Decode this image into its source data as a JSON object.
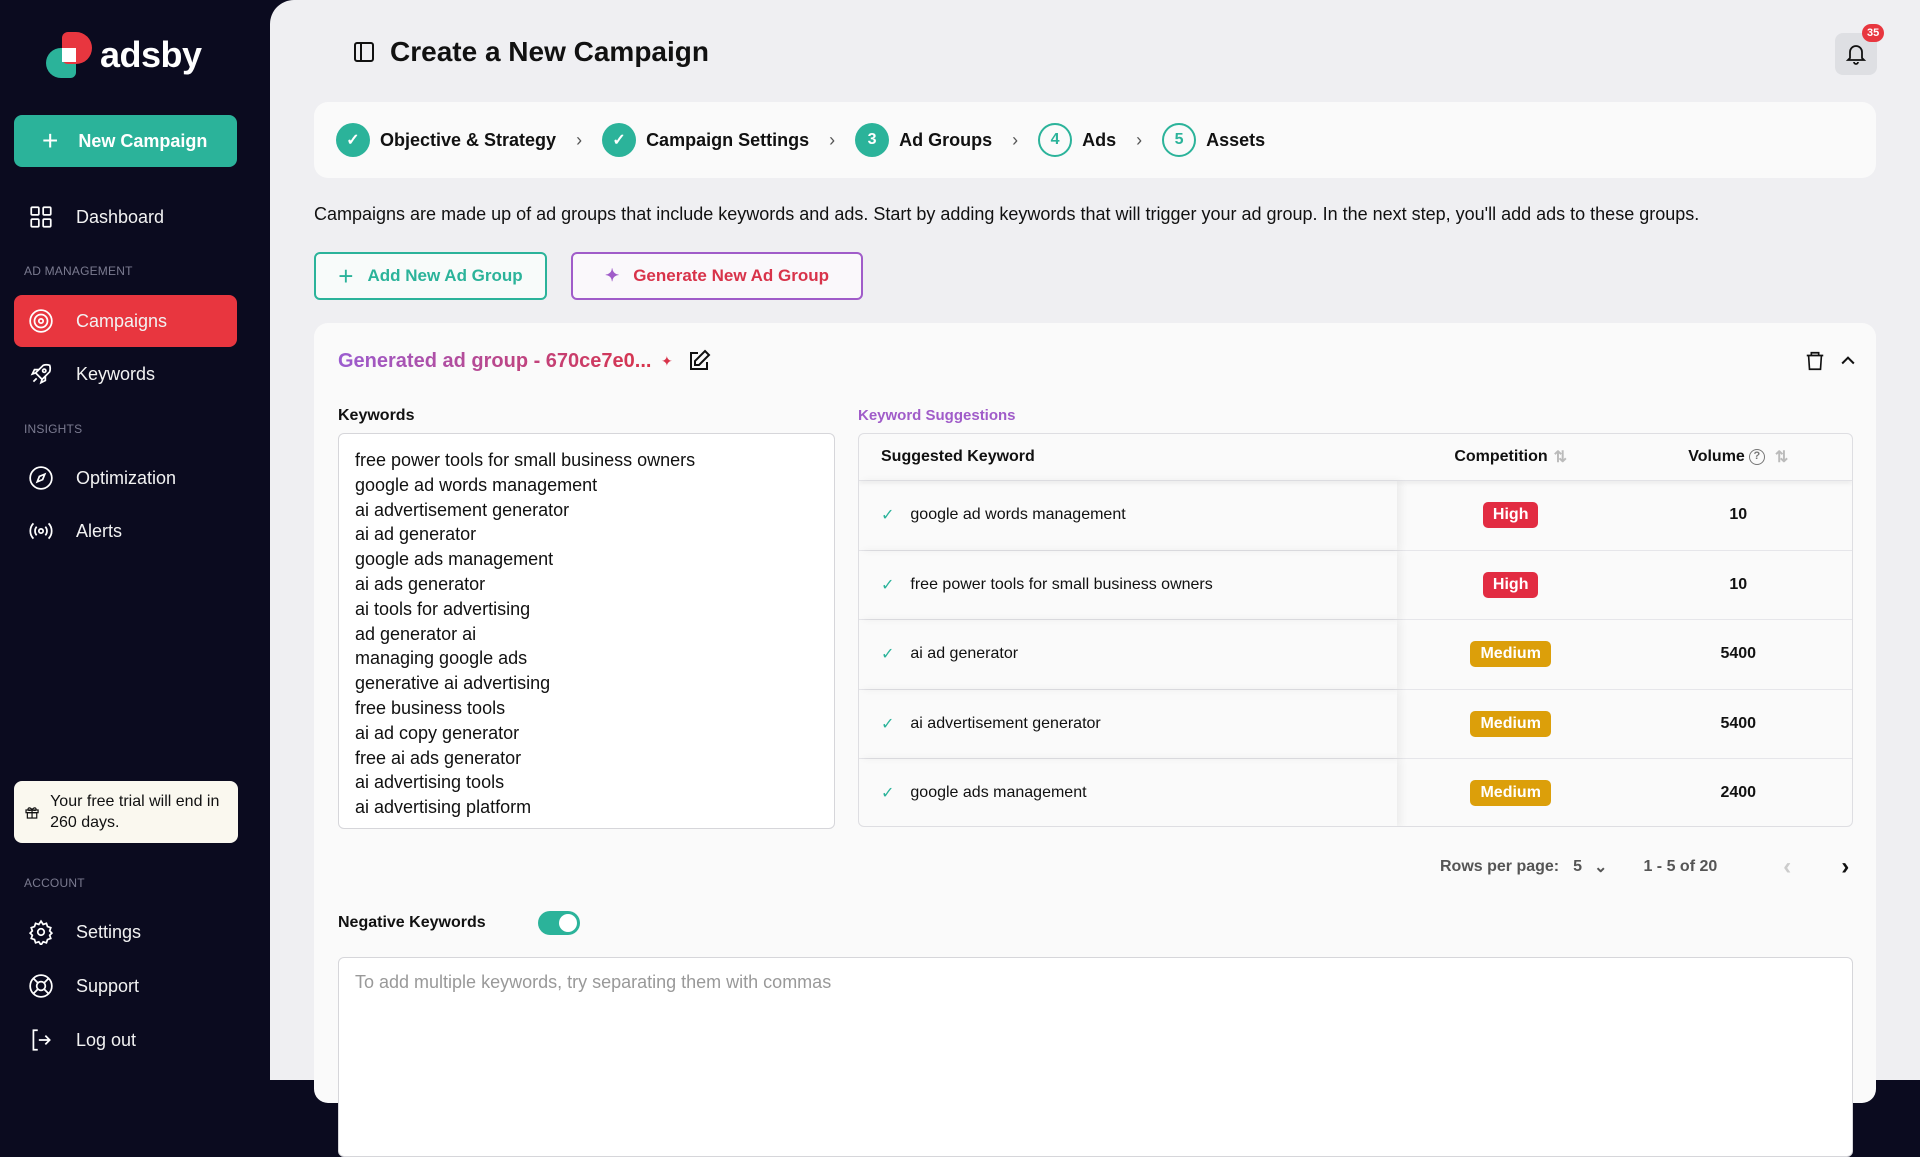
{
  "brand": {
    "name": "adsby"
  },
  "sidebar": {
    "new_campaign": "New Campaign",
    "dashboard": "Dashboard",
    "section_ad": "AD MANAGEMENT",
    "campaigns": "Campaigns",
    "keywords": "Keywords",
    "section_insights": "INSIGHTS",
    "optimization": "Optimization",
    "alerts": "Alerts",
    "trial": "Your free trial will end in 260 days.",
    "section_account": "ACCOUNT",
    "settings": "Settings",
    "support": "Support",
    "logout": "Log out"
  },
  "header": {
    "title": "Create a New Campaign",
    "notifications": "35"
  },
  "steps": [
    {
      "label": "Objective & Strategy",
      "state": "done"
    },
    {
      "label": "Campaign Settings",
      "state": "done"
    },
    {
      "num": "3",
      "label": "Ad Groups",
      "state": "current"
    },
    {
      "num": "4",
      "label": "Ads",
      "state": "todo"
    },
    {
      "num": "5",
      "label": "Assets",
      "state": "todo"
    }
  ],
  "description": "Campaigns are made up of ad groups that include keywords and ads. Start by adding keywords that will trigger your ad group. In the next step, you'll add ads to these groups.",
  "buttons": {
    "add": "Add New Ad Group",
    "generate": "Generate New Ad Group"
  },
  "ad_group": {
    "title": "Generated ad group - 670ce7e0...",
    "keywords_label": "Keywords",
    "keywords": "free power tools for small business owners\ngoogle ad words management\nai advertisement generator\nai ad generator\ngoogle ads management\nai ads generator\nai tools for advertising\nad generator ai\nmanaging google ads\ngenerative ai advertising\nfree business tools\nai ad copy generator\nfree ai ads generator\nai advertising tools\nai advertising platform",
    "suggestions_label": "Keyword Suggestions",
    "columns": [
      "Suggested Keyword",
      "Competition",
      "Volume"
    ],
    "rows": [
      {
        "keyword": "google ad words management",
        "competition": "High",
        "volume": "10"
      },
      {
        "keyword": "free power tools for small business owners",
        "competition": "High",
        "volume": "10"
      },
      {
        "keyword": "ai ad generator",
        "competition": "Medium",
        "volume": "5400"
      },
      {
        "keyword": "ai advertisement generator",
        "competition": "Medium",
        "volume": "5400"
      },
      {
        "keyword": "google ads management",
        "competition": "Medium",
        "volume": "2400"
      }
    ],
    "rows_per_page_label": "Rows per page:",
    "rows_per_page": "5",
    "range": "1 - 5 of 20",
    "negative_label": "Negative Keywords",
    "negative_enabled": true,
    "negative_placeholder": "To add multiple keywords, try separating them with commas"
  },
  "colors": {
    "teal": "#2bb39a",
    "red": "#e8363f",
    "high": "#e22c42",
    "medium": "#dc9f0a",
    "purple": "#a05cc9",
    "sidebar": "#0b0b1f"
  }
}
